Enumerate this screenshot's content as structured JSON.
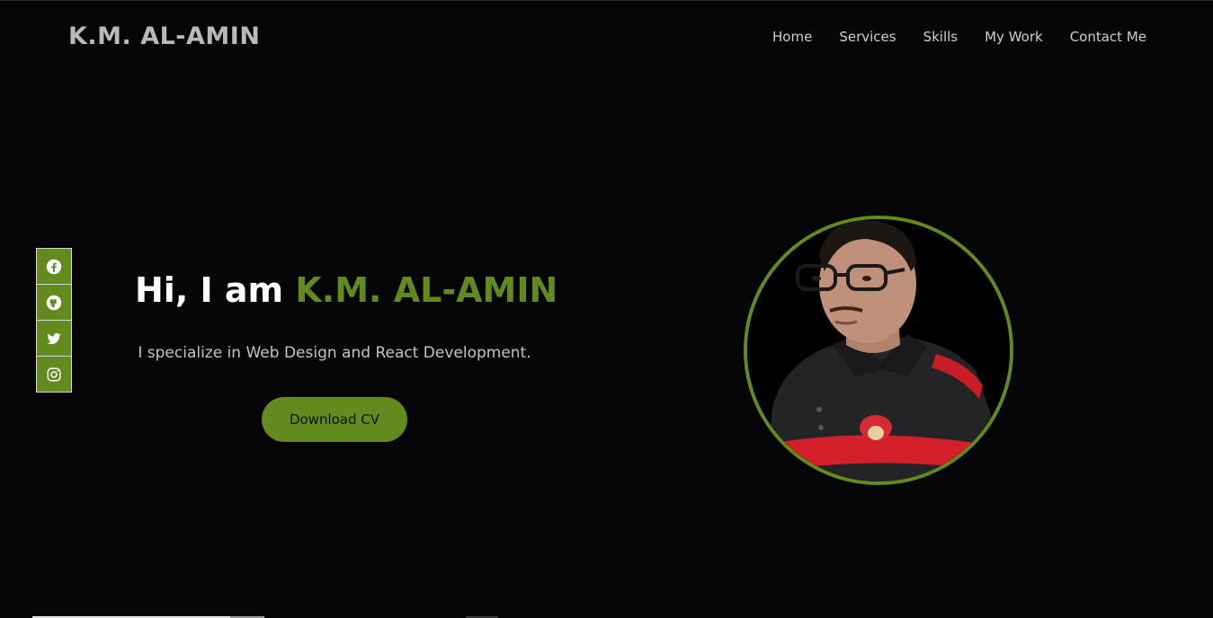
{
  "header": {
    "brand": "K.M. AL-AMIN",
    "nav": [
      "Home",
      "Services",
      "Skills",
      "My Work",
      "Contact Me"
    ]
  },
  "social": {
    "icons": [
      "facebook-icon",
      "github-icon",
      "twitter-icon",
      "instagram-icon"
    ]
  },
  "hero": {
    "greeting": "Hi, I am ",
    "name": "K.M. AL-AMIN",
    "subtitle": "I specialize in Web Design and React Development.",
    "cta_label": "Download CV"
  },
  "colors": {
    "background": "#050507",
    "accent": "#638a1d",
    "text": "#ffffff",
    "muted_text": "#c4c4c4"
  }
}
